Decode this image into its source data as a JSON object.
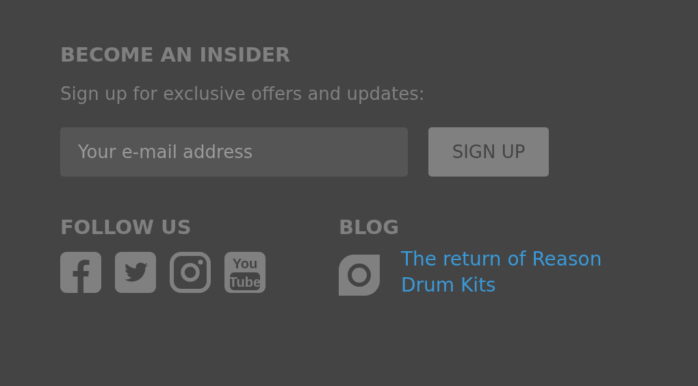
{
  "newsletter": {
    "heading": "BECOME AN INSIDER",
    "text": "Sign up for exclusive offers and updates:",
    "email": {
      "placeholder": "Your e-mail address"
    },
    "button": "SIGN UP"
  },
  "follow": {
    "heading": "FOLLOW US",
    "icons": [
      {
        "kind": "facebook"
      },
      {
        "kind": "twitter"
      },
      {
        "kind": "instagram"
      },
      {
        "kind": "youtube",
        "lines": [
          "You",
          "Tube"
        ]
      }
    ]
  },
  "blog": {
    "heading": "BLOG",
    "link": "The return of Reason Drum Kits"
  }
}
